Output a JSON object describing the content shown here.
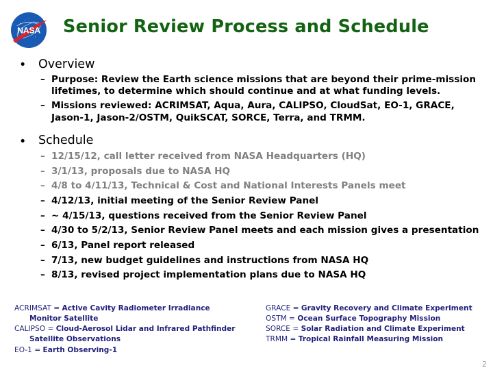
{
  "slide": {
    "title": "Senior Review Process and Schedule",
    "title_color": "#136312",
    "logo_name": "nasa-meatball-logo",
    "page_number": "2"
  },
  "sections": [
    {
      "heading": "Overview",
      "bullet_char": "•",
      "items": [
        {
          "dash": "–",
          "lines": [
            "Purpose: Review the Earth science missions that are beyond their prime-mission",
            "lifetimes, to determine which should continue and at what funding levels."
          ],
          "muted": false
        },
        {
          "dash": "–",
          "lines": [
            "Missions reviewed: ACRIMSAT, Aqua, Aura, CALIPSO, CloudSat, EO-1, GRACE,",
            "Jason-1, Jason-2/OSTM, QuikSCAT, SORCE, Terra, and TRMM."
          ],
          "muted": false
        }
      ]
    },
    {
      "heading": "Schedule",
      "bullet_char": "•",
      "items": [
        {
          "dash": "–",
          "lines": [
            "12/15/12, call letter received from NASA Headquarters (HQ)"
          ],
          "muted": true
        },
        {
          "dash": "–",
          "lines": [
            "3/1/13, proposals due to NASA HQ"
          ],
          "muted": true
        },
        {
          "dash": "–",
          "lines": [
            "4/8 to 4/11/13, Technical & Cost and National Interests Panels meet"
          ],
          "muted": true
        },
        {
          "dash": "–",
          "lines": [
            "4/12/13, initial meeting of the Senior Review Panel"
          ],
          "muted": false
        },
        {
          "dash": "–",
          "lines": [
            "~ 4/15/13, questions received from the Senior Review Panel"
          ],
          "muted": false
        },
        {
          "dash": "–",
          "lines": [
            "4/30 to 5/2/13, Senior Review Panel meets and each mission gives a presentation"
          ],
          "muted": false
        },
        {
          "dash": "–",
          "lines": [
            "6/13, Panel report released"
          ],
          "muted": false
        },
        {
          "dash": "–",
          "lines": [
            "7/13, new budget guidelines and instructions from NASA HQ"
          ],
          "muted": false
        },
        {
          "dash": "–",
          "lines": [
            "8/13, revised project implementation plans due to NASA HQ"
          ],
          "muted": false
        }
      ]
    }
  ],
  "footnotes": {
    "color": "#1f1f7a",
    "left": [
      {
        "acronym": "ACRIMSAT",
        "eq": " = ",
        "definition": "Active Cavity Radiometer Irradiance",
        "continuation": "Monitor Satellite"
      },
      {
        "acronym": "CALIPSO",
        "eq": " = ",
        "definition": "Cloud-Aerosol Lidar and Infrared Pathfinder",
        "continuation": "Satellite Observations"
      },
      {
        "acronym": "EO-1",
        "eq": " = ",
        "definition": "Earth Observing-1",
        "continuation": ""
      }
    ],
    "right": [
      {
        "acronym": "GRACE",
        "eq": " = ",
        "definition": "Gravity Recovery and Climate Experiment",
        "continuation": ""
      },
      {
        "acronym": "OSTM",
        "eq": " = ",
        "definition": "Ocean Surface Topography Mission",
        "continuation": ""
      },
      {
        "acronym": "SORCE",
        "eq": " = ",
        "definition": "Solar Radiation and Climate Experiment",
        "continuation": ""
      },
      {
        "acronym": "TRMM",
        "eq": " = ",
        "definition": "Tropical Rainfall Measuring Mission",
        "continuation": ""
      }
    ]
  }
}
